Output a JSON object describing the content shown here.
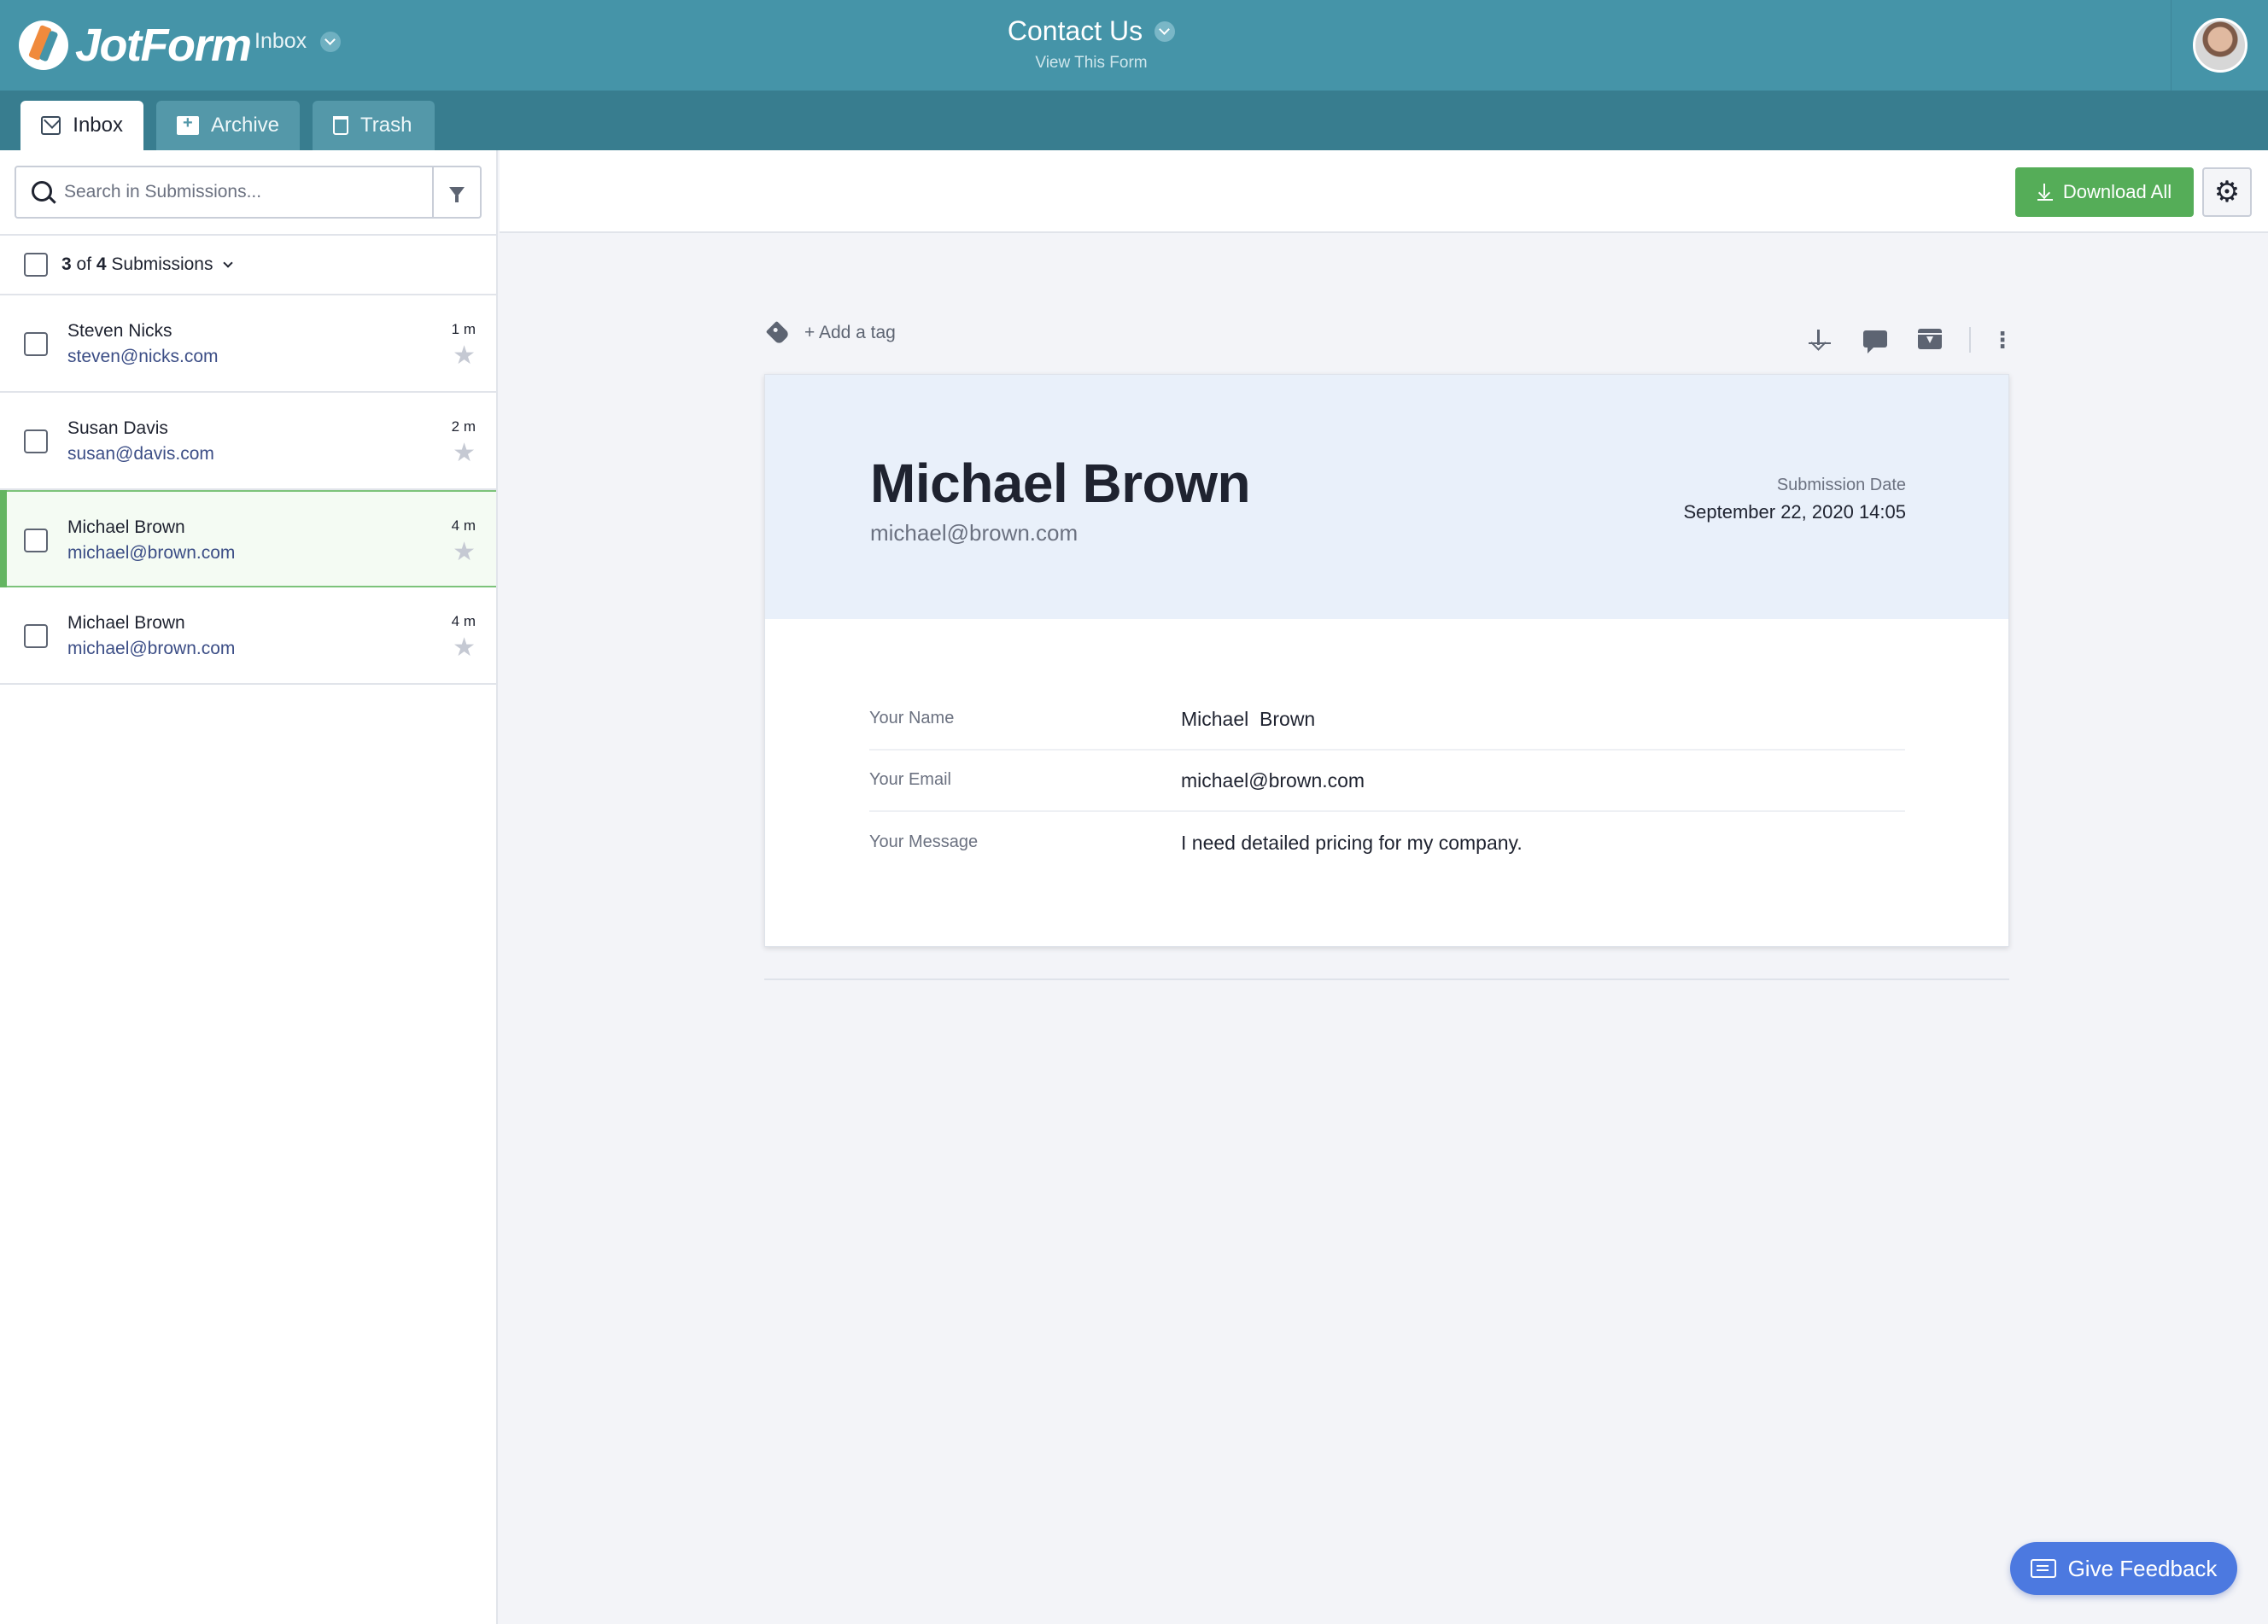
{
  "app": {
    "logo_text": "JotForm",
    "inbox_dropdown_label": "Inbox"
  },
  "form": {
    "title": "Contact Us",
    "view_link": "View This Form"
  },
  "tabs": [
    {
      "label": "Inbox",
      "icon": "mail-icon",
      "active": true
    },
    {
      "label": "Archive",
      "icon": "archive-icon",
      "active": false
    },
    {
      "label": "Trash",
      "icon": "trash-icon",
      "active": false
    }
  ],
  "search": {
    "placeholder": "Search in Submissions...",
    "value": ""
  },
  "submissions_count": {
    "current": "3",
    "of_word": "of",
    "total": "4",
    "suffix": "Submissions"
  },
  "submissions": [
    {
      "name": "Steven Nicks",
      "email": "steven@nicks.com",
      "time": "1 m",
      "selected": false,
      "starred": false
    },
    {
      "name": "Susan Davis",
      "email": "susan@davis.com",
      "time": "2 m",
      "selected": false,
      "starred": false
    },
    {
      "name": "Michael Brown",
      "email": "michael@brown.com",
      "time": "4 m",
      "selected": true,
      "starred": false
    },
    {
      "name": "Michael Brown",
      "email": "michael@brown.com",
      "time": "4 m",
      "selected": false,
      "starred": false
    }
  ],
  "toolbar": {
    "download_all_label": "Download All"
  },
  "detail": {
    "add_tag_label": "+ Add a tag",
    "name": "Michael Brown",
    "email": "michael@brown.com",
    "date_label": "Submission Date",
    "date_value": "September 22, 2020 14:05",
    "fields": [
      {
        "label": "Your Name",
        "value": "Michael  Brown"
      },
      {
        "label": "Your Email",
        "value": "michael@brown.com"
      },
      {
        "label": "Your Message",
        "value": "I need detailed pricing for my company."
      }
    ]
  },
  "feedback_label": "Give Feedback",
  "colors": {
    "header": "#4594a8",
    "tabbar": "#387d8f",
    "accent_green": "#55ad58",
    "feedback_blue": "#4c79e0",
    "detail_header_bg": "#e9f0fa"
  }
}
